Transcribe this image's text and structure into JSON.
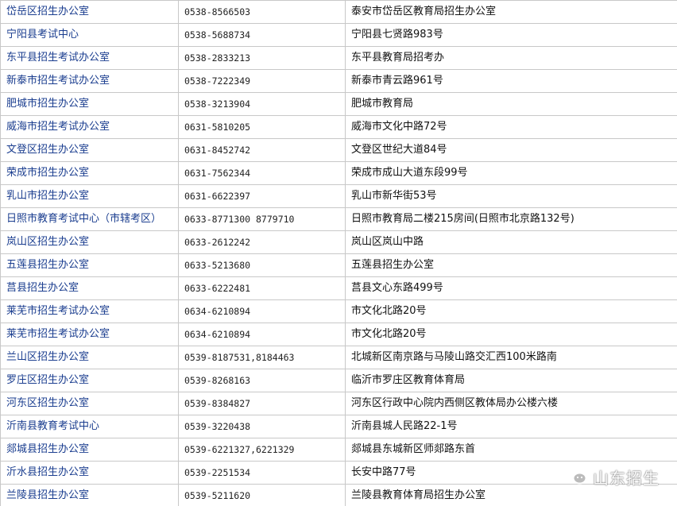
{
  "table": {
    "rows": [
      {
        "office": "岱岳区招生办公室",
        "phone": "0538-8566503",
        "address": "泰安市岱岳区教育局招生办公室"
      },
      {
        "office": "宁阳县考试中心",
        "phone": "0538-5688734",
        "address": "宁阳县七贤路983号"
      },
      {
        "office": "东平县招生考试办公室",
        "phone": "0538-2833213",
        "address": "东平县教育局招考办"
      },
      {
        "office": "新泰市招生考试办公室",
        "phone": "0538-7222349",
        "address": "新泰市青云路961号"
      },
      {
        "office": "肥城市招生办公室",
        "phone": "0538-3213904",
        "address": "肥城市教育局"
      },
      {
        "office": "威海市招生考试办公室",
        "phone": "0631-5810205",
        "address": "威海市文化中路72号"
      },
      {
        "office": "文登区招生办公室",
        "phone": "0631-8452742",
        "address": "文登区世纪大道84号"
      },
      {
        "office": "荣成市招生办公室",
        "phone": "0631-7562344",
        "address": "荣成市成山大道东段99号"
      },
      {
        "office": "乳山市招生办公室",
        "phone": "0631-6622397",
        "address": "乳山市新华街53号"
      },
      {
        "office": "日照市教育考试中心（市辖考区）",
        "phone": "0633-8771300 8779710",
        "address": "日照市教育局二楼215房间(日照市北京路132号)"
      },
      {
        "office": "岚山区招生办公室",
        "phone": "0633-2612242",
        "address": "岚山区岚山中路"
      },
      {
        "office": "五莲县招生办公室",
        "phone": "0633-5213680",
        "address": "五莲县招生办公室"
      },
      {
        "office": "莒县招生办公室",
        "phone": "0633-6222481",
        "address": "莒县文心东路499号"
      },
      {
        "office": "莱芜市招生考试办公室",
        "phone": "0634-6210894",
        "address": "市文化北路20号"
      },
      {
        "office": "莱芜市招生考试办公室",
        "phone": "0634-6210894",
        "address": "市文化北路20号"
      },
      {
        "office": "兰山区招生办公室",
        "phone": "0539-8187531,8184463",
        "address": "北城新区南京路与马陵山路交汇西100米路南"
      },
      {
        "office": "罗庄区招生办公室",
        "phone": "0539-8268163",
        "address": "临沂市罗庄区教育体育局"
      },
      {
        "office": "河东区招生办公室",
        "phone": "0539-8384827",
        "address": "河东区行政中心院内西侧区教体局办公楼六楼"
      },
      {
        "office": "沂南县教育考试中心",
        "phone": "0539-3220438",
        "address": "沂南县城人民路22-1号"
      },
      {
        "office": "郯城县招生办公室",
        "phone": "0539-6221327,6221329",
        "address": "郯城县东城新区师郯路东首"
      },
      {
        "office": "沂水县招生办公室",
        "phone": "0539-2251534",
        "address": "长安中路77号"
      },
      {
        "office": "兰陵县招生办公室",
        "phone": "0539-5211620",
        "address": "兰陵县教育体育局招生办公室"
      }
    ]
  },
  "watermark": {
    "text": "山东招生",
    "icon": "wechat-icon"
  }
}
